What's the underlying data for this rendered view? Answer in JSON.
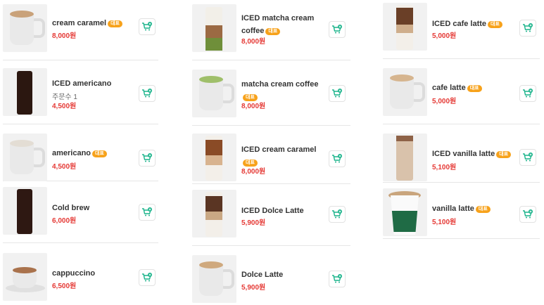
{
  "colors": {
    "price": "#e53935",
    "badge": "#f7a21b",
    "cart_icon": "#19b38a"
  },
  "menu": [
    {
      "name": "cream caramel",
      "badge": "대표",
      "price": "8,000원",
      "icon": "hot-mug"
    },
    {
      "name": "ICED americano",
      "badge": "",
      "orders": "주문수 1",
      "price": "4,500원",
      "icon": "iced-black"
    },
    {
      "name": "americano",
      "badge": "대표",
      "price": "4,500원",
      "icon": "hot-mug"
    },
    {
      "name": "Cold brew",
      "badge": "",
      "price": "6,000원",
      "icon": "iced-black"
    },
    {
      "name": "cappuccino",
      "badge": "",
      "price": "6,500원",
      "icon": "cup-saucer"
    },
    {
      "name": "ICED matcha cream coffee",
      "badge": "대표",
      "price": "8,000원",
      "icon": "iced-matcha"
    },
    {
      "name": "matcha cream coffee",
      "badge": "대표",
      "price": "8,000원",
      "icon": "hot-matcha"
    },
    {
      "name": "ICED cream caramel",
      "badge": "대표",
      "price": "8,000원",
      "icon": "iced-latte"
    },
    {
      "name": "ICED Dolce Latte",
      "badge": "",
      "price": "5,900원",
      "icon": "iced-latte"
    },
    {
      "name": "Dolce Latte",
      "badge": "",
      "price": "5,900원",
      "icon": "hot-mug"
    },
    {
      "name": "ICED cafe latte",
      "badge": "대표",
      "price": "5,000원",
      "icon": "iced-latte"
    },
    {
      "name": "cafe latte",
      "badge": "대표",
      "price": "5,000원",
      "icon": "hot-mug"
    },
    {
      "name": "ICED vanilla latte",
      "badge": "대표",
      "price": "5,100원",
      "icon": "iced-latte"
    },
    {
      "name": "vanilla latte",
      "badge": "대표",
      "price": "5,100원",
      "icon": "paper-cup"
    }
  ]
}
